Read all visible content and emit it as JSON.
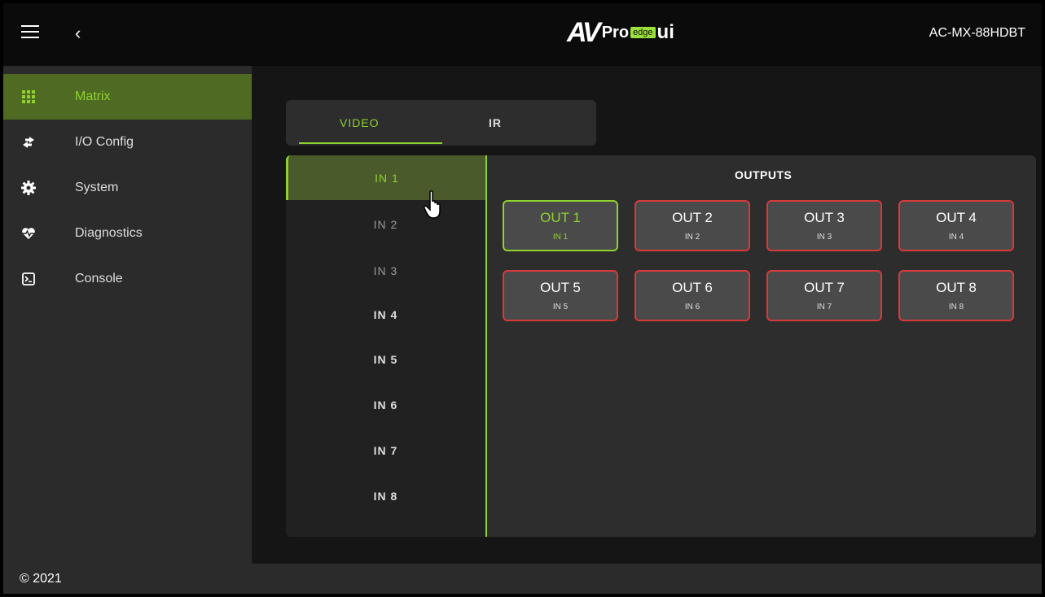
{
  "header": {
    "logo": {
      "av": "AV",
      "pro": "Pro",
      "edge": "edge",
      "ui": "ui"
    },
    "device_name": "AC-MX-88HDBT"
  },
  "sidebar": {
    "items": [
      {
        "label": "Matrix",
        "icon": "grid-icon",
        "active": true
      },
      {
        "label": "I/O Config",
        "icon": "swap-arrows-icon",
        "active": false
      },
      {
        "label": "System",
        "icon": "gear-icon",
        "active": false
      },
      {
        "label": "Diagnostics",
        "icon": "heart-pulse-icon",
        "active": false
      },
      {
        "label": "Console",
        "icon": "terminal-icon",
        "active": false
      }
    ]
  },
  "tabs": [
    {
      "label": "VIDEO",
      "active": true
    },
    {
      "label": "IR",
      "active": false
    }
  ],
  "inputs": [
    "IN 1",
    "IN 2",
    "IN 3",
    "IN 4",
    "IN 5",
    "IN 6",
    "IN 7",
    "IN 8"
  ],
  "outputs_title": "OUTPUTS",
  "outputs": [
    {
      "name": "OUT 1",
      "source": "IN 1",
      "routed": true
    },
    {
      "name": "OUT 2",
      "source": "IN 2",
      "routed": false
    },
    {
      "name": "OUT 3",
      "source": "IN 3",
      "routed": false
    },
    {
      "name": "OUT 4",
      "source": "IN 4",
      "routed": false
    },
    {
      "name": "OUT 5",
      "source": "IN 5",
      "routed": false
    },
    {
      "name": "OUT 6",
      "source": "IN 6",
      "routed": false
    },
    {
      "name": "OUT 7",
      "source": "IN 7",
      "routed": false
    },
    {
      "name": "OUT 8",
      "source": "IN 8",
      "routed": false
    }
  ],
  "footer": {
    "copyright": "© 2021"
  },
  "colors": {
    "accent": "#8fd12f",
    "unrouted": "#d83a3a",
    "active_bg": "#4f6a22"
  }
}
